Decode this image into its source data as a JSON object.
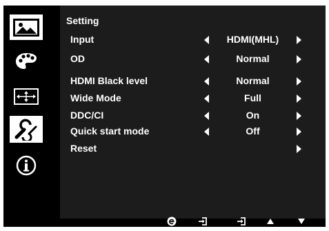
{
  "menu": {
    "title": "Setting",
    "rows": [
      {
        "label": "Input",
        "value": "HDMI(MHL)",
        "left": true,
        "right": true
      },
      {
        "label": "OD",
        "value": "Normal",
        "left": true,
        "right": true
      },
      {
        "label": "HDMI Black level",
        "value": "Normal",
        "left": true,
        "right": true
      },
      {
        "label": "Wide Mode",
        "value": "Full",
        "left": true,
        "right": true
      },
      {
        "label": "DDC/CI",
        "value": "On",
        "left": true,
        "right": true
      },
      {
        "label": "Quick start mode",
        "value": "Off",
        "left": true,
        "right": true
      },
      {
        "label": "Reset",
        "value": "",
        "left": false,
        "right": true
      }
    ]
  },
  "sidebar": {
    "items": [
      {
        "icon": "picture-icon",
        "active": true
      },
      {
        "icon": "palette-icon",
        "active": false
      },
      {
        "icon": "screen-position-icon",
        "active": false
      },
      {
        "icon": "wrench-settings-icon",
        "active": true
      },
      {
        "icon": "info-icon",
        "active": false
      }
    ]
  },
  "footer": {
    "buttons": [
      "e-key-icon",
      "enter-icon",
      "exit-icon",
      "up-arrow-icon",
      "down-arrow-icon"
    ]
  },
  "colors": {
    "background": "#000000",
    "panel": "#1c1c1c",
    "text": "#ffffff",
    "active_tab": "#ffffff"
  }
}
